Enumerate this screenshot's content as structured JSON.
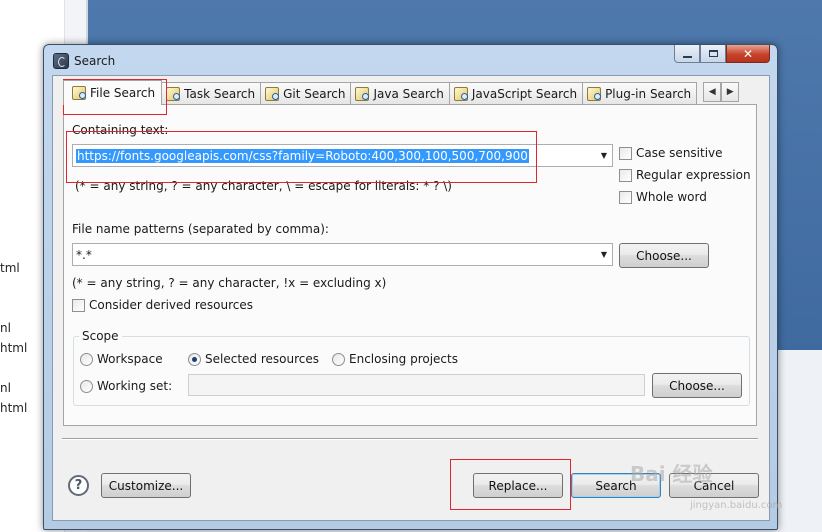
{
  "background": {
    "fragments": [
      "tml",
      "nl",
      "html",
      "nl",
      "html"
    ]
  },
  "window": {
    "title": "Search",
    "minimize_label": "",
    "maximize_label": "",
    "close_label": "✕"
  },
  "tabs": [
    {
      "label": "File Search",
      "active": true
    },
    {
      "label": "Task Search"
    },
    {
      "label": "Git Search"
    },
    {
      "label": "Java Search"
    },
    {
      "label": "JavaScript Search"
    },
    {
      "label": "Plug-in Search"
    }
  ],
  "tab_scroll": {
    "left": "◀",
    "right": "▶"
  },
  "containing_text": {
    "label": "Containing text:",
    "value": "https://fonts.googleapis.com/css?family=Roboto:400,300,100,500,700,900",
    "hint": "(* = any string, ? = any character, \\ = escape for literals: * ? \\)"
  },
  "options": {
    "case_sensitive": "Case sensitive",
    "regular_expression": "Regular expression",
    "whole_word": "Whole word"
  },
  "file_patterns": {
    "label": "File name patterns (separated by comma):",
    "value": "*.*",
    "hint": "(* = any string, ? = any character, !x = excluding x)",
    "choose_label": "Choose..."
  },
  "derived": {
    "label": "Consider derived resources"
  },
  "scope": {
    "title": "Scope",
    "workspace": "Workspace",
    "selected_resources": "Selected resources",
    "enclosing_projects": "Enclosing projects",
    "selected": "selected_resources",
    "working_set": "Working set:",
    "working_set_value": "",
    "choose_label": "Choose..."
  },
  "footer": {
    "help": "?",
    "customize": "Customize...",
    "replace": "Replace...",
    "search": "Search",
    "cancel": "Cancel"
  },
  "watermark": {
    "text": "Bai 经验",
    "url": "jingyan.baidu.com"
  },
  "colors": {
    "highlight_border": "#e0262d",
    "selection": "#3399ff",
    "title_bar": "#c3d8ee"
  }
}
